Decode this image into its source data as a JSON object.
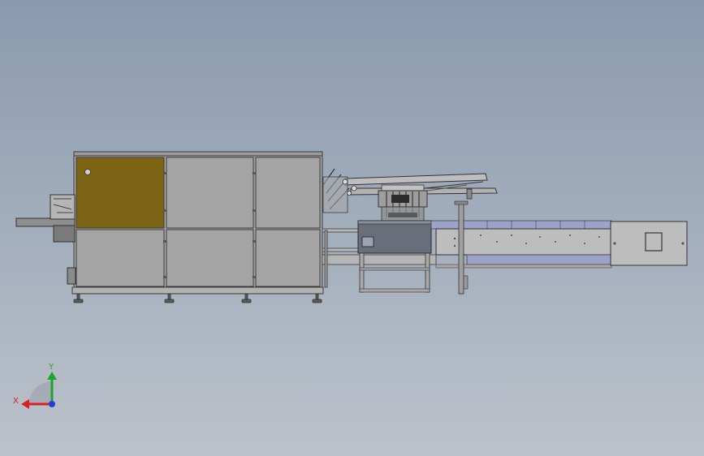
{
  "cad_view": {
    "background": {
      "top": "#8a9aae",
      "bottom": "#bcc2cb"
    },
    "colors": {
      "panel_fill": "#a4a4a4",
      "panel_edge": "#3c3c3c",
      "highlight_panel": "#7d6415",
      "frame_dark": "#4a4a4a",
      "conveyor_fill": "#bdbdbd",
      "conveyor_belt": "#9aa3c8",
      "dark_block": "#6a6e7a"
    },
    "triad": {
      "x_label": "X",
      "y_label": "Y",
      "x_color": "#d62222",
      "y_color": "#1fa32a",
      "z_color": "#2a3bd6"
    }
  }
}
